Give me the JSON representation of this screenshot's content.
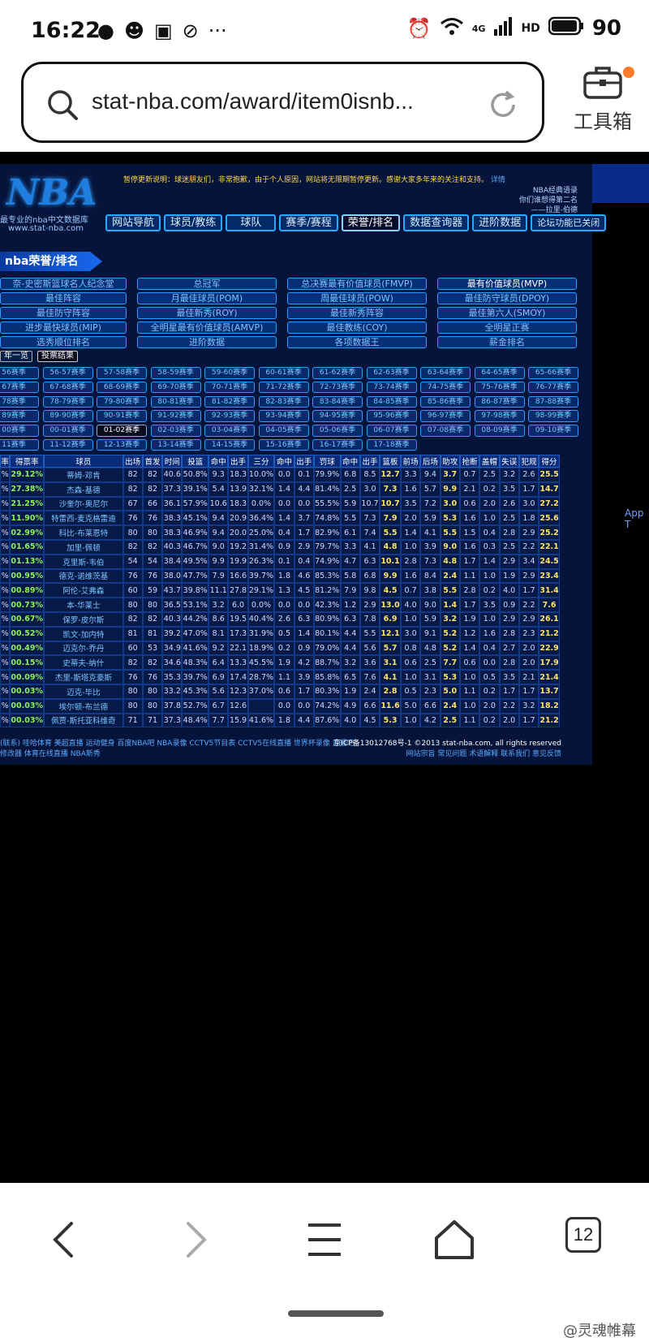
{
  "status_bar": {
    "time": "16:22",
    "network": "4G",
    "hd": "HD",
    "battery": "90"
  },
  "browser": {
    "url": "stat-nba.com/award/item0isnb...",
    "toolbox_label": "工具箱"
  },
  "site": {
    "logo_text": "NBA",
    "logo_sub": "最专业的nba中文数据库",
    "logo_url": "www.stat-nba.com",
    "notice": "暂停更新说明：球迷朋友们，非常抱歉，由于个人原因，网站将无限期暂停更新。感谢大家多年来的关注和支持。",
    "notice_link": "详情",
    "quote_title": "NBA经典语录",
    "quote_line": "你们谁想得第二名",
    "quote_author": "——拉里-伯德",
    "nav": [
      "网站导航",
      "球员/教练",
      "球队",
      "赛季/赛程",
      "荣誉/排名",
      "数据查询器",
      "进阶数据",
      "论坛功能已关闭"
    ],
    "section_title": "nba荣誉/排名",
    "awards": [
      "奈-史密斯篮球名人纪念堂",
      "总冠军",
      "总决赛最有价值球员(FMVP)",
      "最有价值球员(MVP)",
      "最佳阵容",
      "月最佳球员(POM)",
      "周最佳球员(POW)",
      "最佳防守球员(DPOY)",
      "最佳防守阵容",
      "最佳新秀(ROY)",
      "最佳新秀阵容",
      "最佳第六人(SMOY)",
      "进步最快球员(MIP)",
      "全明星最有价值球员(AMVP)",
      "最佳教练(COY)",
      "全明星正赛",
      "选秀顺位排名",
      "进阶数据",
      "各项数据王",
      "薪金排名"
    ],
    "filters": [
      "年一览",
      "投票结果"
    ],
    "seasons": [
      "56赛季",
      "56-57赛季",
      "57-58赛季",
      "58-59赛季",
      "59-60赛季",
      "60-61赛季",
      "61-62赛季",
      "62-63赛季",
      "63-64赛季",
      "64-65赛季",
      "65-66赛季",
      "67赛季",
      "67-68赛季",
      "68-69赛季",
      "69-70赛季",
      "70-71赛季",
      "71-72赛季",
      "72-73赛季",
      "73-74赛季",
      "74-75赛季",
      "75-76赛季",
      "76-77赛季",
      "78赛季",
      "78-79赛季",
      "79-80赛季",
      "80-81赛季",
      "81-82赛季",
      "82-83赛季",
      "83-84赛季",
      "84-85赛季",
      "85-86赛季",
      "86-87赛季",
      "87-88赛季",
      "89赛季",
      "89-90赛季",
      "90-91赛季",
      "91-92赛季",
      "92-93赛季",
      "93-94赛季",
      "94-95赛季",
      "95-96赛季",
      "96-97赛季",
      "97-98赛季",
      "98-99赛季",
      "00赛季",
      "00-01赛季",
      "01-02赛季",
      "02-03赛季",
      "03-04赛季",
      "04-05赛季",
      "05-06赛季",
      "06-07赛季",
      "07-08赛季",
      "08-09赛季",
      "09-10赛季",
      "11赛季",
      "11-12赛季",
      "12-13赛季",
      "13-14赛季",
      "14-15赛季",
      "15-16赛季",
      "16-17赛季",
      "17-18赛季"
    ],
    "active_season": "01-02赛季",
    "table_headers": [
      "率",
      "得票率",
      "球员",
      "出场",
      "首发",
      "时间",
      "投篮",
      "命中",
      "出手",
      "三分",
      "命中",
      "出手",
      "罚球",
      "命中",
      "出手",
      "篮板",
      "前场",
      "后场",
      "助攻",
      "抢断",
      "盖帽",
      "失误",
      "犯规",
      "得分"
    ],
    "rows": [
      [
        "%",
        "29.12%",
        "蒂姆-邓肯",
        "82",
        "82",
        "40.6",
        "50.8%",
        "9.3",
        "18.3",
        "10.0%",
        "0.0",
        "0.1",
        "79.9%",
        "6.8",
        "8.5",
        "12.7",
        "3.3",
        "9.4",
        "3.7",
        "0.7",
        "2.5",
        "3.2",
        "2.6",
        "25.5"
      ],
      [
        "%",
        "27.38%",
        "杰森-基德",
        "82",
        "82",
        "37.3",
        "39.1%",
        "5.4",
        "13.9",
        "32.1%",
        "1.4",
        "4.4",
        "81.4%",
        "2.5",
        "3.0",
        "7.3",
        "1.6",
        "5.7",
        "9.9",
        "2.1",
        "0.2",
        "3.5",
        "1.7",
        "14.7"
      ],
      [
        "%",
        "21.25%",
        "沙奎尔-奥尼尔",
        "67",
        "66",
        "36.1",
        "57.9%",
        "10.6",
        "18.3",
        "0.0%",
        "0.0",
        "0.0",
        "55.5%",
        "5.9",
        "10.7",
        "10.7",
        "3.5",
        "7.2",
        "3.0",
        "0.6",
        "2.0",
        "2.6",
        "3.0",
        "27.2"
      ],
      [
        "%",
        "11.90%",
        "特雷西-麦克格雷迪",
        "76",
        "76",
        "38.3",
        "45.1%",
        "9.4",
        "20.9",
        "36.4%",
        "1.4",
        "3.7",
        "74.8%",
        "5.5",
        "7.3",
        "7.9",
        "2.0",
        "5.9",
        "5.3",
        "1.6",
        "1.0",
        "2.5",
        "1.8",
        "25.6"
      ],
      [
        "%",
        "02.99%",
        "科比-布莱恩特",
        "80",
        "80",
        "38.3",
        "46.9%",
        "9.4",
        "20.0",
        "25.0%",
        "0.4",
        "1.7",
        "82.9%",
        "6.1",
        "7.4",
        "5.5",
        "1.4",
        "4.1",
        "5.5",
        "1.5",
        "0.4",
        "2.8",
        "2.9",
        "25.2"
      ],
      [
        "%",
        "01.65%",
        "加里-佩顿",
        "82",
        "82",
        "40.3",
        "46.7%",
        "9.0",
        "19.2",
        "31.4%",
        "0.9",
        "2.9",
        "79.7%",
        "3.3",
        "4.1",
        "4.8",
        "1.0",
        "3.9",
        "9.0",
        "1.6",
        "0.3",
        "2.5",
        "2.2",
        "22.1"
      ],
      [
        "%",
        "01.13%",
        "克里斯-韦伯",
        "54",
        "54",
        "38.4",
        "49.5%",
        "9.9",
        "19.9",
        "26.3%",
        "0.1",
        "0.4",
        "74.9%",
        "4.7",
        "6.3",
        "10.1",
        "2.8",
        "7.3",
        "4.8",
        "1.7",
        "1.4",
        "2.9",
        "3.4",
        "24.5"
      ],
      [
        "%",
        "00.95%",
        "德克-诺维茨基",
        "76",
        "76",
        "38.0",
        "47.7%",
        "7.9",
        "16.6",
        "39.7%",
        "1.8",
        "4.6",
        "85.3%",
        "5.8",
        "6.8",
        "9.9",
        "1.6",
        "8.4",
        "2.4",
        "1.1",
        "1.0",
        "1.9",
        "2.9",
        "23.4"
      ],
      [
        "%",
        "00.89%",
        "阿伦-艾弗森",
        "60",
        "59",
        "43.7",
        "39.8%",
        "11.1",
        "27.8",
        "29.1%",
        "1.3",
        "4.5",
        "81.2%",
        "7.9",
        "9.8",
        "4.5",
        "0.7",
        "3.8",
        "5.5",
        "2.8",
        "0.2",
        "4.0",
        "1.7",
        "31.4"
      ],
      [
        "%",
        "00.73%",
        "本-华莱士",
        "80",
        "80",
        "36.5",
        "53.1%",
        "3.2",
        "6.0",
        "0.0%",
        "0.0",
        "0.0",
        "42.3%",
        "1.2",
        "2.9",
        "13.0",
        "4.0",
        "9.0",
        "1.4",
        "1.7",
        "3.5",
        "0.9",
        "2.2",
        "7.6"
      ],
      [
        "%",
        "00.67%",
        "保罗-皮尔斯",
        "82",
        "82",
        "40.3",
        "44.2%",
        "8.6",
        "19.5",
        "40.4%",
        "2.6",
        "6.3",
        "80.9%",
        "6.3",
        "7.8",
        "6.9",
        "1.0",
        "5.9",
        "3.2",
        "1.9",
        "1.0",
        "2.9",
        "2.9",
        "26.1"
      ],
      [
        "%",
        "00.52%",
        "凯文-加内特",
        "81",
        "81",
        "39.2",
        "47.0%",
        "8.1",
        "17.3",
        "31.9%",
        "0.5",
        "1.4",
        "80.1%",
        "4.4",
        "5.5",
        "12.1",
        "3.0",
        "9.1",
        "5.2",
        "1.2",
        "1.6",
        "2.8",
        "2.3",
        "21.2"
      ],
      [
        "%",
        "00.49%",
        "迈克尔-乔丹",
        "60",
        "53",
        "34.9",
        "41.6%",
        "9.2",
        "22.1",
        "18.9%",
        "0.2",
        "0.9",
        "79.0%",
        "4.4",
        "5.6",
        "5.7",
        "0.8",
        "4.8",
        "5.2",
        "1.4",
        "0.4",
        "2.7",
        "2.0",
        "22.9"
      ],
      [
        "%",
        "00.15%",
        "史蒂夫-纳什",
        "82",
        "82",
        "34.6",
        "48.3%",
        "6.4",
        "13.3",
        "45.5%",
        "1.9",
        "4.2",
        "88.7%",
        "3.2",
        "3.6",
        "3.1",
        "0.6",
        "2.5",
        "7.7",
        "0.6",
        "0.0",
        "2.8",
        "2.0",
        "17.9"
      ],
      [
        "%",
        "00.09%",
        "杰里-斯塔克豪斯",
        "76",
        "76",
        "35.3",
        "39.7%",
        "6.9",
        "17.4",
        "28.7%",
        "1.1",
        "3.9",
        "85.8%",
        "6.5",
        "7.6",
        "4.1",
        "1.0",
        "3.1",
        "5.3",
        "1.0",
        "0.5",
        "3.5",
        "2.1",
        "21.4"
      ],
      [
        "%",
        "00.03%",
        "迈克-毕比",
        "80",
        "80",
        "33.2",
        "45.3%",
        "5.6",
        "12.3",
        "37.0%",
        "0.6",
        "1.7",
        "80.3%",
        "1.9",
        "2.4",
        "2.8",
        "0.5",
        "2.3",
        "5.0",
        "1.1",
        "0.2",
        "1.7",
        "1.7",
        "13.7"
      ],
      [
        "%",
        "00.03%",
        "埃尔顿-布兰德",
        "80",
        "80",
        "37.8",
        "52.7%",
        "6.7",
        "12.6",
        "",
        "0.0",
        "0.0",
        "74.2%",
        "4.9",
        "6.6",
        "11.6",
        "5.0",
        "6.6",
        "2.4",
        "1.0",
        "2.0",
        "2.2",
        "3.2",
        "18.2"
      ],
      [
        "%",
        "00.03%",
        "佩贾-斯托亚科维奇",
        "71",
        "71",
        "37.3",
        "48.4%",
        "7.7",
        "15.9",
        "41.6%",
        "1.8",
        "4.4",
        "87.6%",
        "4.0",
        "4.5",
        "5.3",
        "1.0",
        "4.2",
        "2.5",
        "1.1",
        "0.2",
        "2.0",
        "1.7",
        "21.2"
      ]
    ],
    "footer_left_1": "(联系) 哇哈体育 美超直播 运动健身 百度NBA吧 NBA录像 CCTV5节目表 CCTV5在线直播 世界杯录像 直播吧",
    "footer_left_2": "修改器 体育在线直播 NBA新秀",
    "footer_right_1": "京ICP备13012768号-1 ©2013 stat-nba.com, all rights reserved",
    "footer_right_2": "网站宗旨 常见问题 术语解释 联系我们 意见反馈",
    "side_label": "App T"
  },
  "bottom_nav": {
    "tabs_count": "12",
    "watermark": "@灵魂帷幕"
  }
}
